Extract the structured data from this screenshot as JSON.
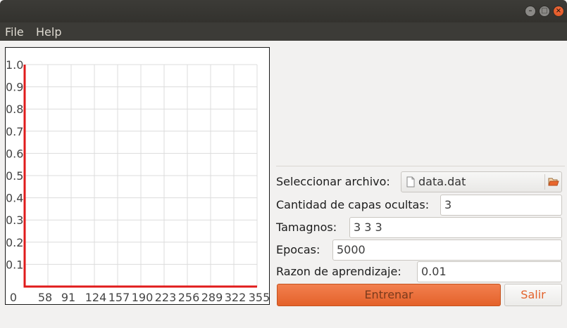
{
  "menu": {
    "file": "File",
    "help": "Help"
  },
  "window_buttons": {
    "minimize": "–",
    "maximize": "□",
    "close": "×"
  },
  "form": {
    "file_label": "Seleccionar archivo:",
    "file_value": "data.dat",
    "layers_label": "Cantidad de capas ocultas:",
    "layers_value": "3",
    "sizes_label": "Tamagnos:",
    "sizes_value": "3 3 3",
    "epochs_label": "Epocas:",
    "epochs_value": "5000",
    "rate_label": "Razon de aprendizaje:",
    "rate_value": "0.01"
  },
  "buttons": {
    "train": "Entrenar",
    "exit": "Salir"
  },
  "icons": {
    "file": "file-icon",
    "folder": "folder-open-icon"
  },
  "colors": {
    "series": "#e01b1b",
    "accent": "#e95420",
    "grid": "#dcdcdc"
  },
  "chart_data": {
    "type": "line",
    "x_ticks": [
      "0",
      "58",
      "91",
      "124",
      "157",
      "190",
      "223",
      "256",
      "289",
      "322",
      "355"
    ],
    "y_ticks": [
      "1.0",
      "0.9",
      "0.8",
      "0.7",
      "0.6",
      "0.5",
      "0.4",
      "0.3",
      "0.2",
      "0.1"
    ],
    "xlim": [
      0,
      355
    ],
    "ylim": [
      0,
      1.0
    ],
    "grid": true,
    "series": [
      {
        "x": [
          0,
          0,
          355
        ],
        "y": [
          1.0,
          0,
          0
        ]
      }
    ]
  }
}
